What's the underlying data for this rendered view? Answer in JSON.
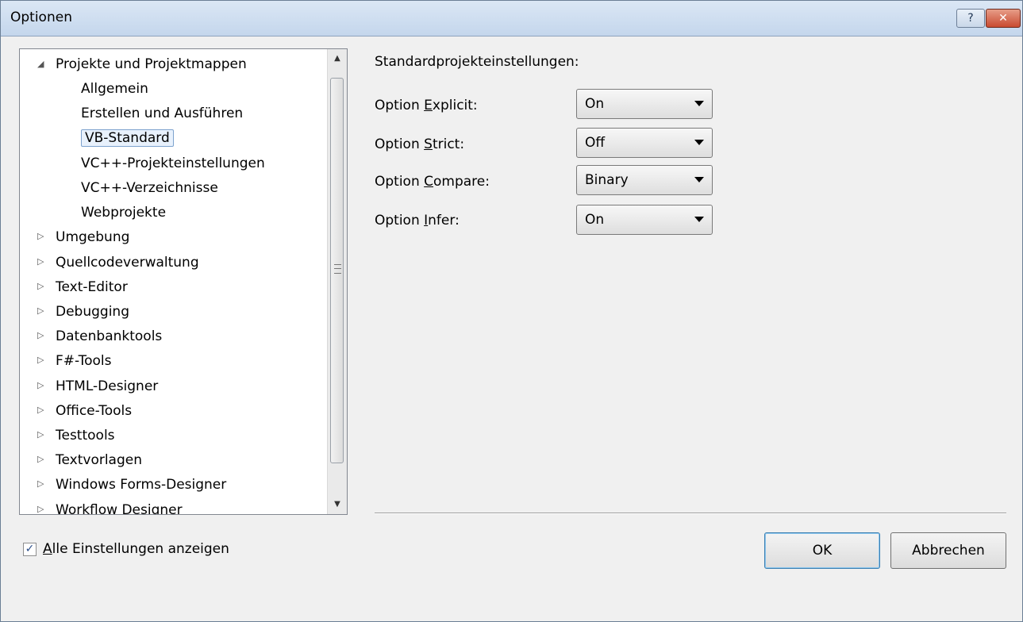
{
  "window": {
    "title": "Optionen",
    "help_glyph": "?",
    "close_glyph": "✕"
  },
  "tree": {
    "items": [
      {
        "label": "Projekte und Projektmappen",
        "level": 0,
        "expanded": true
      },
      {
        "label": "Allgemein",
        "level": 1
      },
      {
        "label": "Erstellen und Ausführen",
        "level": 1
      },
      {
        "label": "VB-Standard",
        "level": 1,
        "selected": true
      },
      {
        "label": "VC++-Projekteinstellungen",
        "level": 1
      },
      {
        "label": "VC++-Verzeichnisse",
        "level": 1
      },
      {
        "label": "Webprojekte",
        "level": 1
      },
      {
        "label": "Umgebung",
        "level": 0,
        "expanded": false
      },
      {
        "label": "Quellcodeverwaltung",
        "level": 0,
        "expanded": false
      },
      {
        "label": "Text-Editor",
        "level": 0,
        "expanded": false
      },
      {
        "label": "Debugging",
        "level": 0,
        "expanded": false
      },
      {
        "label": "Datenbanktools",
        "level": 0,
        "expanded": false
      },
      {
        "label": "F#-Tools",
        "level": 0,
        "expanded": false
      },
      {
        "label": "HTML-Designer",
        "level": 0,
        "expanded": false
      },
      {
        "label": "Office-Tools",
        "level": 0,
        "expanded": false
      },
      {
        "label": "Testtools",
        "level": 0,
        "expanded": false
      },
      {
        "label": "Textvorlagen",
        "level": 0,
        "expanded": false
      },
      {
        "label": "Windows Forms-Designer",
        "level": 0,
        "expanded": false
      },
      {
        "label": "Workflow Designer",
        "level": 0,
        "expanded": false
      }
    ]
  },
  "settings": {
    "section_title": "Standardprojekteinstellungen:",
    "options": [
      {
        "prefix": "Option ",
        "mnemonic": "E",
        "rest": "xplicit:",
        "value": "On"
      },
      {
        "prefix": "Option ",
        "mnemonic": "S",
        "rest": "trict:",
        "value": "Off"
      },
      {
        "prefix": "Option ",
        "mnemonic": "C",
        "rest": "ompare:",
        "value": "Binary"
      },
      {
        "prefix": "Option ",
        "mnemonic": "I",
        "rest": "nfer:",
        "value": "On"
      }
    ]
  },
  "footer": {
    "show_all_mnemonic": "A",
    "show_all_rest": "lle Einstellungen anzeigen",
    "show_all_checked": true,
    "check_glyph": "✓",
    "ok_label": "OK",
    "cancel_label": "Abbrechen"
  }
}
